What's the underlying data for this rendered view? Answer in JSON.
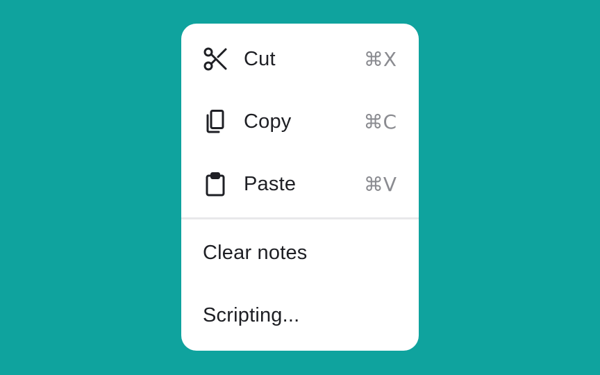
{
  "background_color": "#0fa39e",
  "menu": {
    "items": [
      {
        "label": "Cut",
        "shortcut": "⌘X",
        "icon": "scissors-icon"
      },
      {
        "label": "Copy",
        "shortcut": "⌘C",
        "icon": "copy-icon"
      },
      {
        "label": "Paste",
        "shortcut": "⌘V",
        "icon": "clipboard-icon"
      }
    ],
    "secondary_items": [
      {
        "label": "Clear notes"
      },
      {
        "label": "Scripting..."
      }
    ]
  }
}
